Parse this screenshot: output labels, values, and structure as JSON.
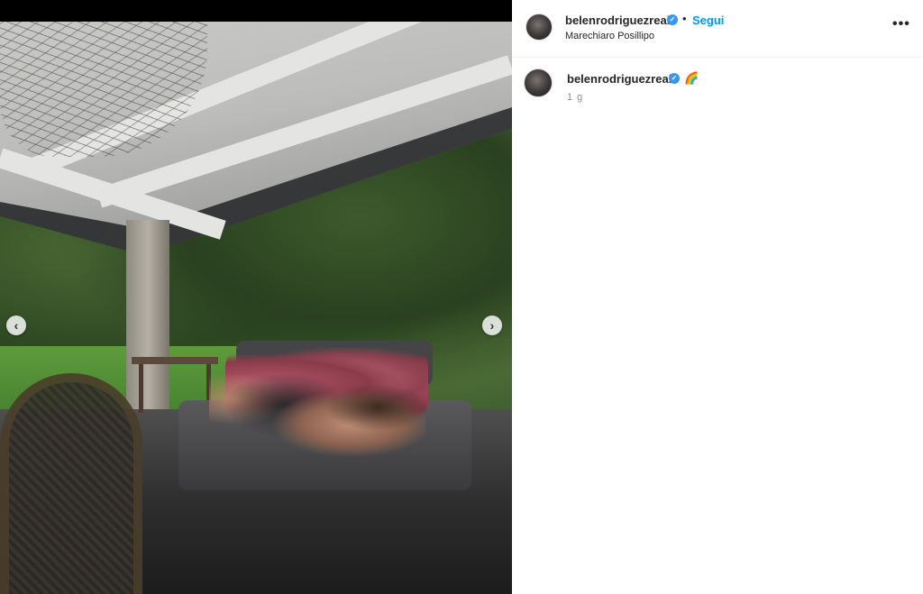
{
  "post": {
    "username": "belenrodriguezreal",
    "follow_label": "Segui",
    "separator": "•",
    "location": "Marechiaro Posillipo",
    "more_label": "•••"
  },
  "caption": {
    "username": "belenrodriguezreal",
    "text": "🌈",
    "time": "1 g"
  },
  "carousel": {
    "prev_label": "‹",
    "next_label": "›"
  },
  "colors": {
    "verified_badge": "#3897f0",
    "follow_link": "#0095f6"
  },
  "icons": [
    "chevron-left-icon",
    "chevron-right-icon",
    "verified-badge-icon",
    "more-options-icon"
  ]
}
